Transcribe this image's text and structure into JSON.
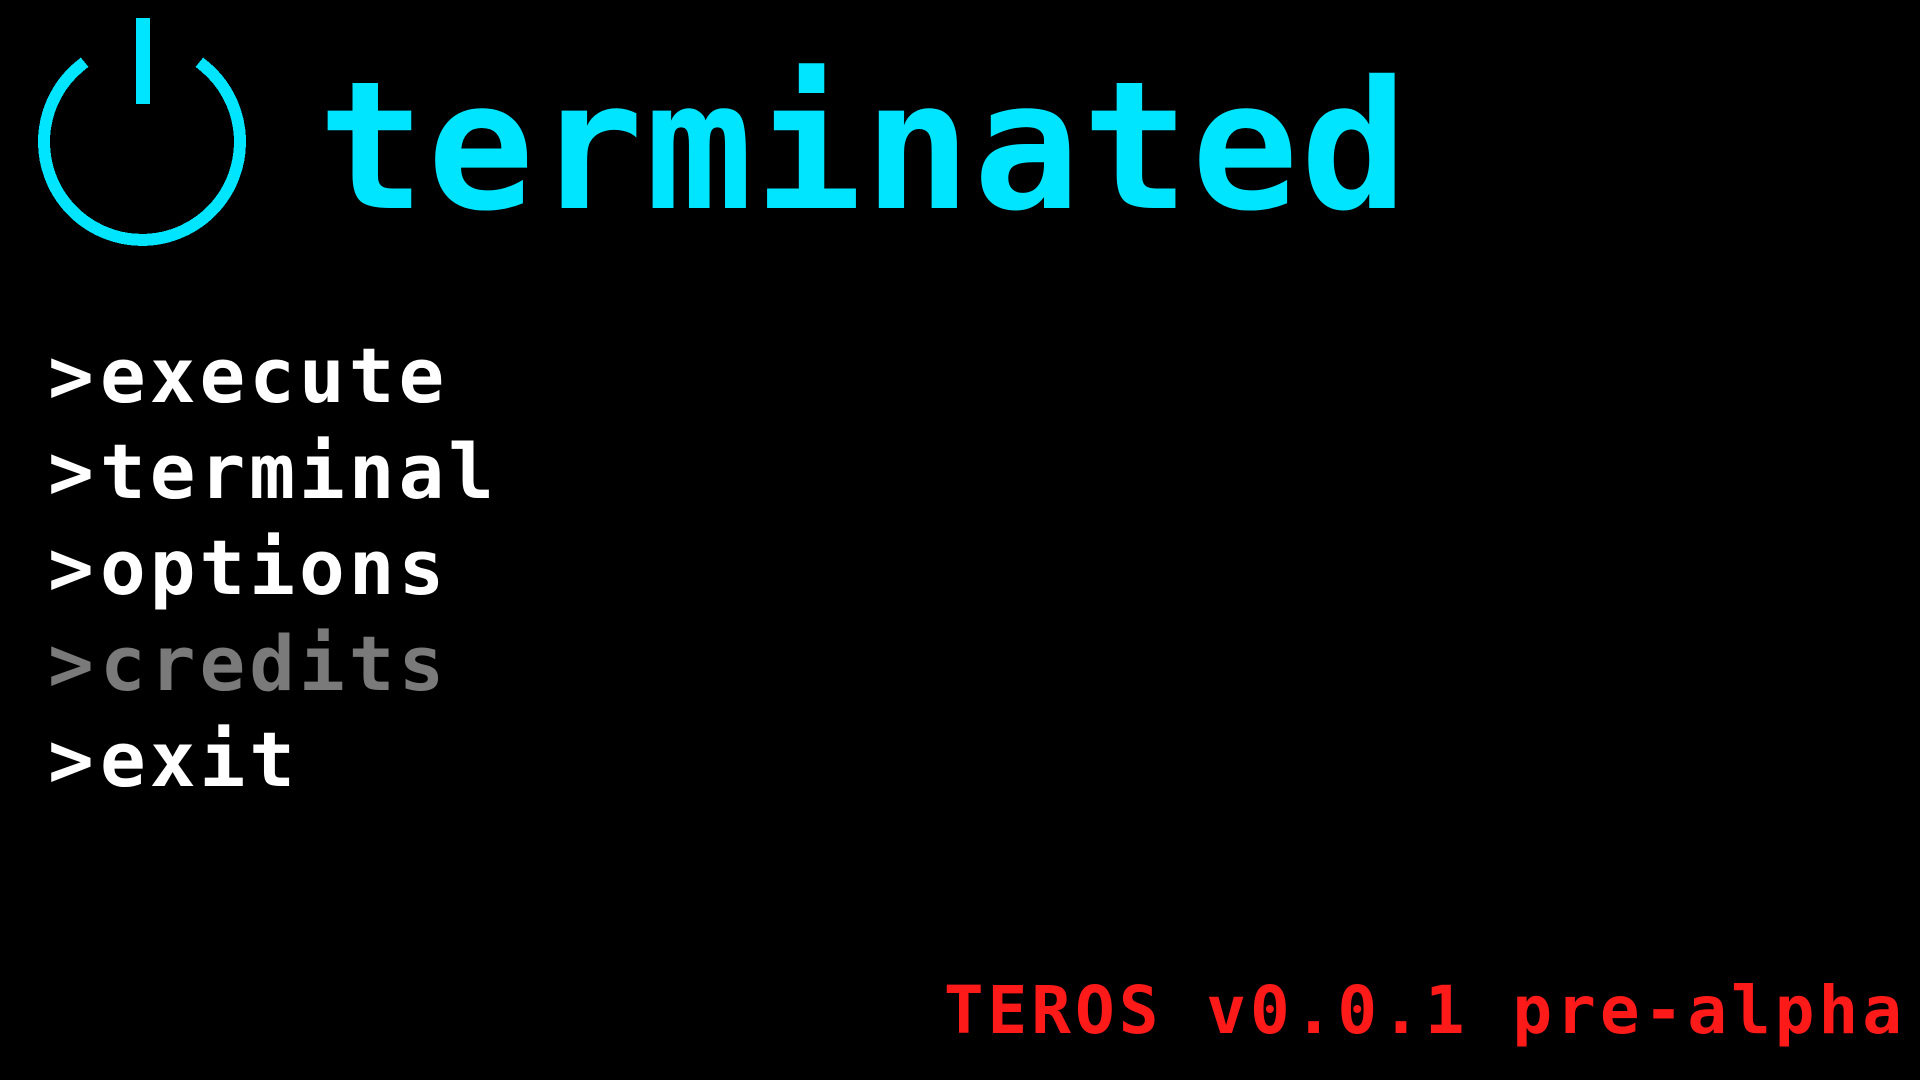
{
  "colors": {
    "background": "#000000",
    "accent": "#00e5ff",
    "menu_text": "#ffffff",
    "menu_text_disabled": "#7a7a7a",
    "version": "#ff1a1a"
  },
  "logo": {
    "icon": "power-icon"
  },
  "title": "terminated",
  "menu": {
    "prompt": ">",
    "items": [
      {
        "label": "execute",
        "enabled": true
      },
      {
        "label": "terminal",
        "enabled": true
      },
      {
        "label": "options",
        "enabled": true
      },
      {
        "label": "credits",
        "enabled": false
      },
      {
        "label": "exit",
        "enabled": true
      }
    ]
  },
  "version": "TEROS v0.0.1 pre-alpha"
}
